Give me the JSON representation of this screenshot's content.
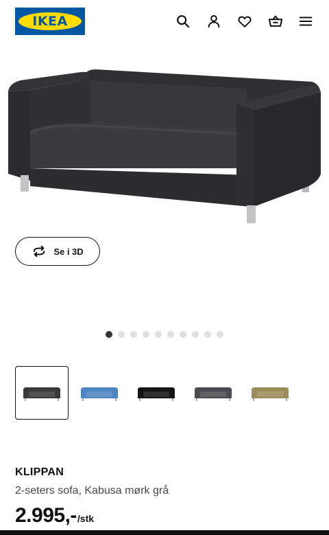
{
  "header": {
    "logo_text": "IKEA",
    "brand_blue": "#0058a3",
    "brand_yellow": "#ffdb00",
    "icons": [
      "search-icon",
      "account-icon",
      "favourites-icon",
      "cart-icon",
      "menu-icon"
    ]
  },
  "gallery": {
    "view_3d_label": "Se i 3D",
    "dot_count": 10,
    "active_dot": 0,
    "thumbnails": [
      {
        "color_name": "Kabusa mørk grå",
        "color": "#3a3a3d",
        "selected": true
      },
      {
        "color_name": "blue",
        "color": "#4e86c4",
        "selected": false
      },
      {
        "color_name": "black",
        "color": "#141414",
        "selected": false
      },
      {
        "color_name": "dark grey",
        "color": "#4a4b50",
        "selected": false
      },
      {
        "color_name": "olive",
        "color": "#9a8d5a",
        "selected": false
      }
    ]
  },
  "product": {
    "name": "KLIPPAN",
    "description": "2-seters sofa, Kabusa mørk grå",
    "price": "2.995,-",
    "price_unit": "/stk"
  }
}
